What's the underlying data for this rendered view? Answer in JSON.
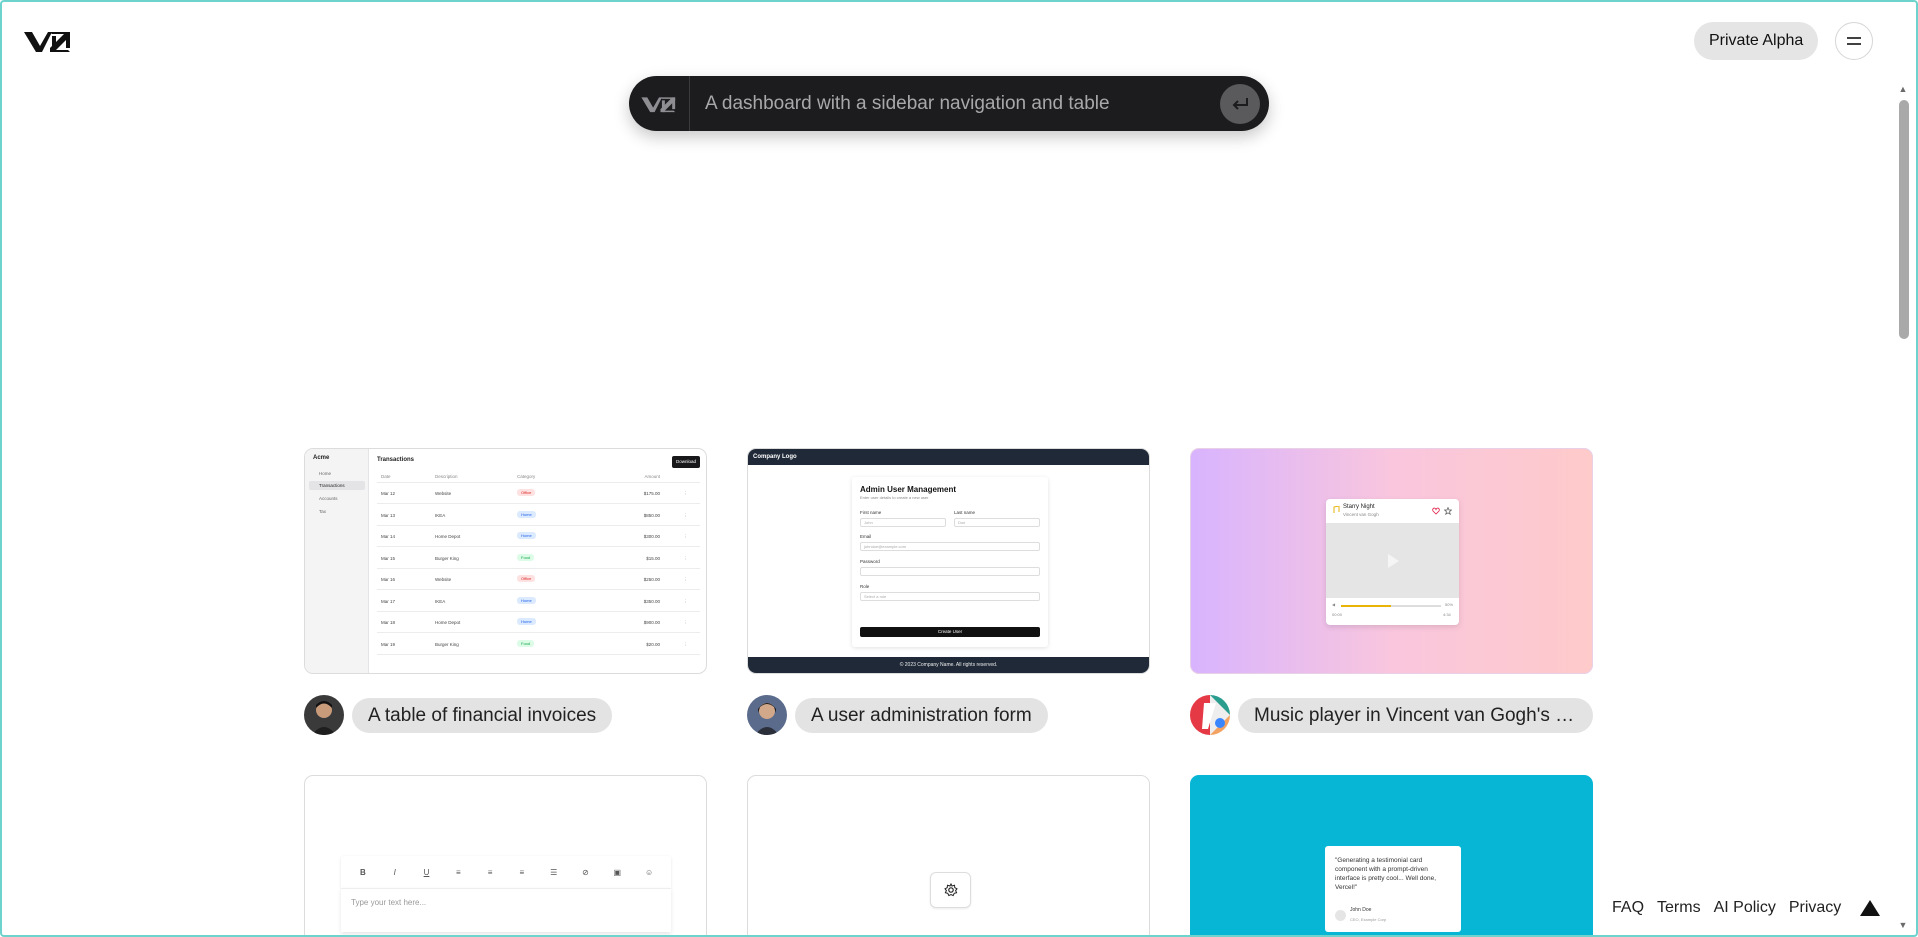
{
  "header": {
    "logo_icon": "v0-logo-icon",
    "alpha_label": "Private Alpha",
    "menu_icon": "hamburger-menu-icon"
  },
  "prompt": {
    "logo_icon": "v0-logo-icon",
    "placeholder": "A dashboard with a sidebar navigation and table",
    "submit_icon": "enter-return-icon"
  },
  "gallery": [
    {
      "caption": "A table of financial invoices",
      "preview": {
        "brand": "Acme",
        "nav": [
          "Home",
          "Transactions",
          "Accounts",
          "Tax"
        ],
        "title": "Transactions",
        "download_label": "Download",
        "columns": [
          "Date",
          "Description",
          "Category",
          "Amount"
        ],
        "rows": [
          [
            "Mar 12",
            "Website",
            "Office",
            "$175.00"
          ],
          [
            "Mar 13",
            "IKEA",
            "Home",
            "$850.00"
          ],
          [
            "Mar 14",
            "Home Depot",
            "Home",
            "$300.00"
          ],
          [
            "Mar 15",
            "Burger King",
            "Food",
            "$15.00"
          ],
          [
            "Mar 16",
            "Website",
            "Office",
            "$250.00"
          ],
          [
            "Mar 17",
            "IKEA",
            "Home",
            "$350.00"
          ],
          [
            "Mar 18",
            "Home Depot",
            "Home",
            "$900.00"
          ],
          [
            "Mar 19",
            "Burger King",
            "Food",
            "$20.00"
          ]
        ]
      }
    },
    {
      "caption": "A user administration form",
      "preview": {
        "topbar_title": "Company Logo",
        "form_title": "Admin User Management",
        "form_subtitle": "Enter user details to create a new user",
        "first_name_label": "First name",
        "first_name_placeholder": "John",
        "last_name_label": "Last name",
        "last_name_placeholder": "Doe",
        "email_label": "Email",
        "email_placeholder": "johndoe@example.com",
        "password_label": "Password",
        "role_label": "Role",
        "role_placeholder": "Select a role",
        "submit_label": "Create User",
        "footer_text": "© 2023 Company Name. All rights reserved."
      }
    },
    {
      "caption": "Music player in Vincent van Gogh's s...",
      "preview": {
        "song_title": "Starry Night",
        "artist": "Vincent van Gogh",
        "progress": 0.5,
        "volume_label": "50%",
        "time_elapsed": "00:00",
        "time_total": "4:34"
      }
    },
    {
      "preview": {
        "toolbar": [
          "B",
          "I",
          "U",
          "align-left",
          "align-center",
          "align-right",
          "list",
          "link",
          "image",
          "emoji"
        ],
        "placeholder": "Type your text here..."
      }
    },
    {
      "preview": {
        "icon": "gear-icon"
      }
    },
    {
      "preview": {
        "quote": "\"Generating a testimonial card component with a prompt-driven interface is pretty cool... Well done, Vercel!\"",
        "author": "John Doe",
        "author_title": "CEO, Example Corp"
      }
    }
  ],
  "footer": {
    "links": [
      "FAQ",
      "Terms",
      "AI Policy",
      "Privacy"
    ],
    "icon": "vercel-triangle-icon"
  }
}
